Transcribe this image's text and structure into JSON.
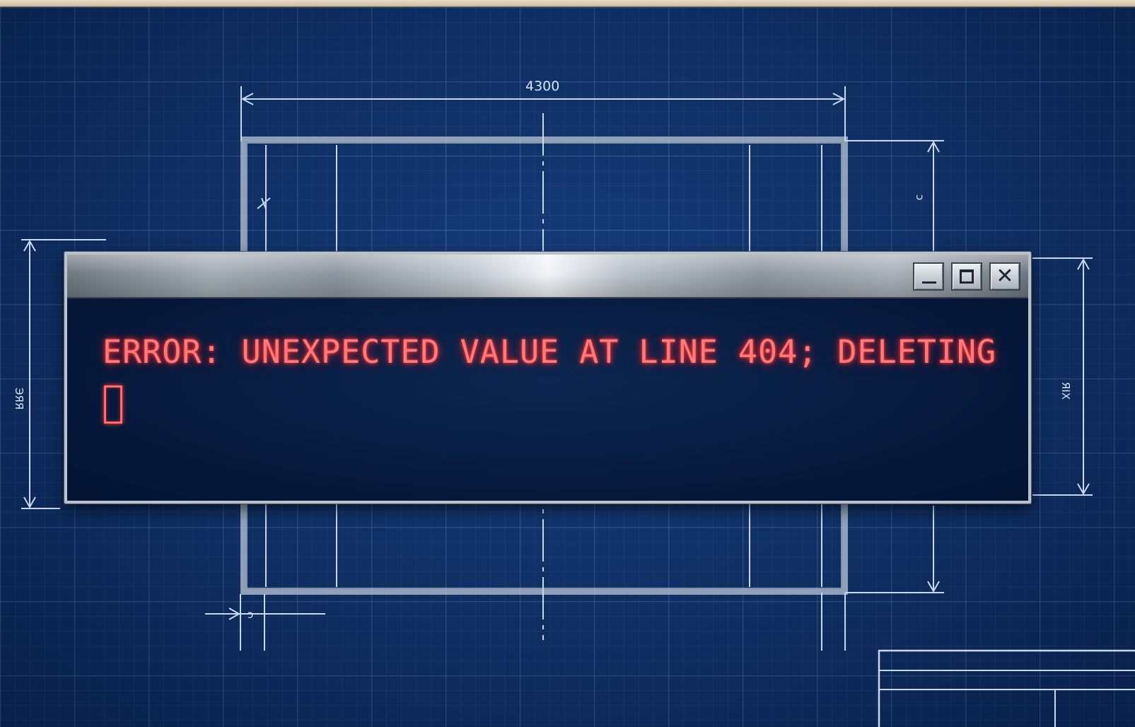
{
  "blueprint": {
    "top_dimension": "4300",
    "right_upper_dimension": "ↄ",
    "left_dimension": "ЭЯЯ",
    "right_dimension": "ЯIX",
    "bottom_small_dimension": "ↄ"
  },
  "dialog": {
    "buttons": {
      "minimize": "minimize",
      "maximize": "maximize",
      "close_glyph": "✕"
    },
    "error_text": "ERROR: UNEXPECTED VALUE AT LINE 404; DELETING",
    "colors": {
      "error_text": "#ff7a78",
      "console_bg": "#06183a",
      "blueprint_bg": "#0d2f66"
    }
  }
}
